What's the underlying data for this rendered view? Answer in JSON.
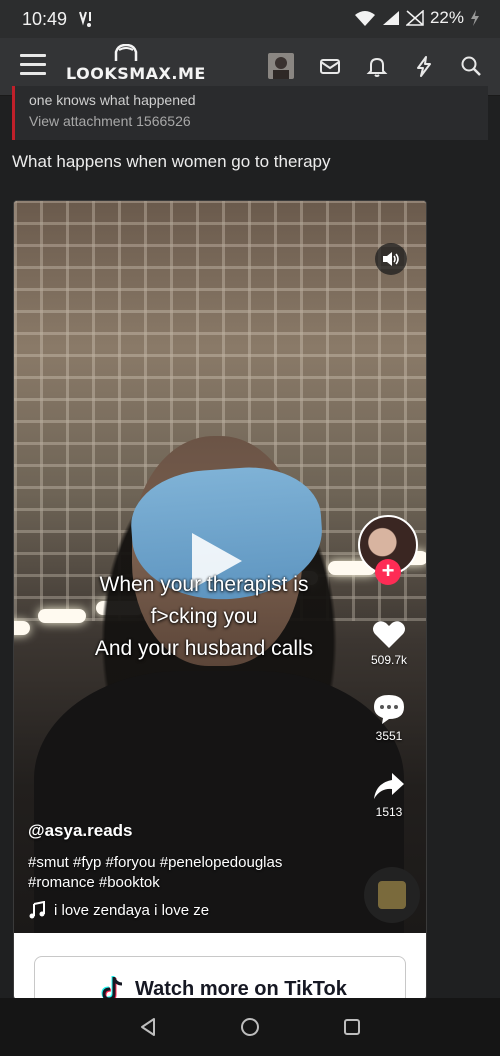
{
  "status_bar": {
    "time": "10:49",
    "battery": "22%"
  },
  "nav": {
    "logo_text": "LOOKSMAX.ME",
    "icons": [
      "menu-icon",
      "avatar",
      "mail-icon",
      "bell-icon",
      "bolt-icon",
      "search-icon"
    ]
  },
  "quote": {
    "line1": "one knows what happened",
    "line2": "View attachment 1566526"
  },
  "post": {
    "text": "What happens when women go to therapy"
  },
  "tiktok": {
    "caption_lines": [
      "When your therapist is",
      "f>cking you",
      "And your husband calls"
    ],
    "likes": "509.7k",
    "comments": "3551",
    "shares": "1513",
    "username": "@asya.reads",
    "hashtags_line1": "#smut #fyp #foryou #penelopedouglas",
    "hashtags_line2": "#romance #booktok",
    "music": "i love zendaya   i love ze",
    "watch_more": "Watch more on TikTok",
    "accent_color": "#fe2c55"
  }
}
